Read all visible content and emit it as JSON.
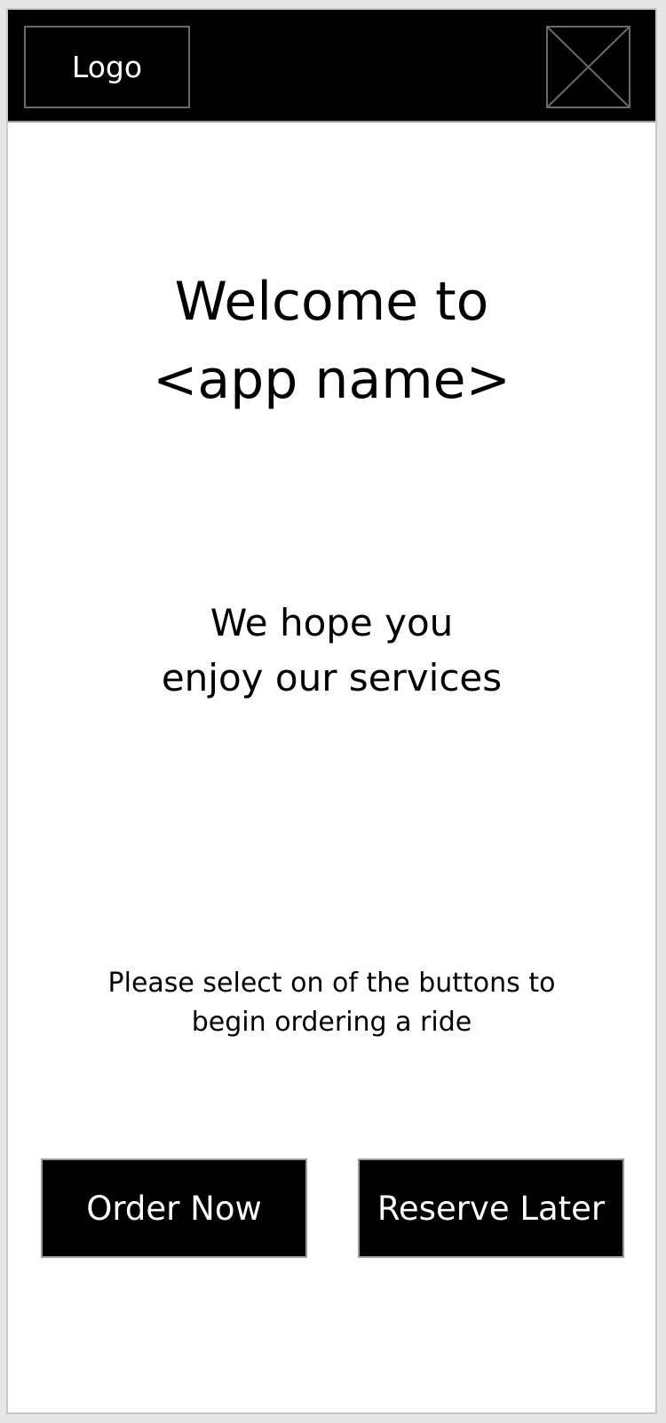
{
  "header": {
    "logo_label": "Logo",
    "close_icon": "close-x-placeholder-icon"
  },
  "welcome": {
    "line1": "Welcome to",
    "line2": "<app name>"
  },
  "tagline": {
    "line1": "We hope you",
    "line2": "enjoy our services"
  },
  "instruction": {
    "line1": "Please select on of the buttons to",
    "line2": "begin ordering a ride"
  },
  "actions": {
    "order_now_label": "Order Now",
    "reserve_later_label": "Reserve Later"
  },
  "colors": {
    "header_bg": "#000000",
    "button_bg": "#000000",
    "button_text": "#ffffff",
    "page_bg": "#ffffff"
  }
}
